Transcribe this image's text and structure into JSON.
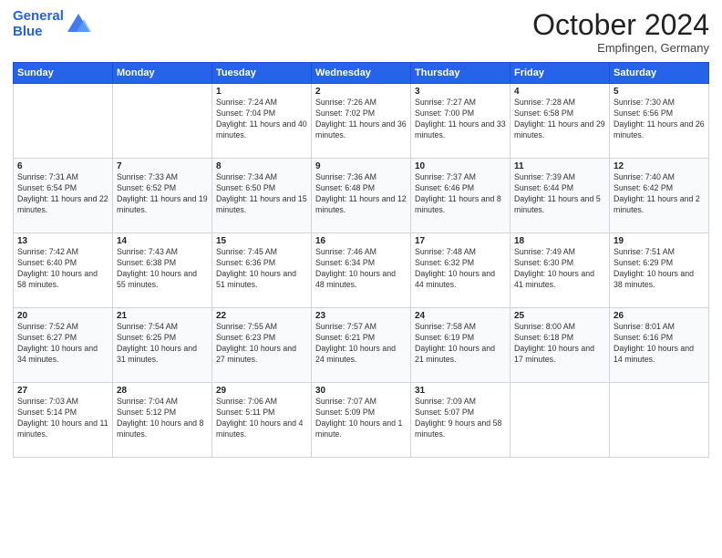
{
  "header": {
    "logo_line1": "General",
    "logo_line2": "Blue",
    "month": "October 2024",
    "location": "Empfingen, Germany"
  },
  "days_of_week": [
    "Sunday",
    "Monday",
    "Tuesday",
    "Wednesday",
    "Thursday",
    "Friday",
    "Saturday"
  ],
  "weeks": [
    [
      {
        "day": "",
        "info": ""
      },
      {
        "day": "",
        "info": ""
      },
      {
        "day": "1",
        "info": "Sunrise: 7:24 AM\nSunset: 7:04 PM\nDaylight: 11 hours and 40 minutes."
      },
      {
        "day": "2",
        "info": "Sunrise: 7:26 AM\nSunset: 7:02 PM\nDaylight: 11 hours and 36 minutes."
      },
      {
        "day": "3",
        "info": "Sunrise: 7:27 AM\nSunset: 7:00 PM\nDaylight: 11 hours and 33 minutes."
      },
      {
        "day": "4",
        "info": "Sunrise: 7:28 AM\nSunset: 6:58 PM\nDaylight: 11 hours and 29 minutes."
      },
      {
        "day": "5",
        "info": "Sunrise: 7:30 AM\nSunset: 6:56 PM\nDaylight: 11 hours and 26 minutes."
      }
    ],
    [
      {
        "day": "6",
        "info": "Sunrise: 7:31 AM\nSunset: 6:54 PM\nDaylight: 11 hours and 22 minutes."
      },
      {
        "day": "7",
        "info": "Sunrise: 7:33 AM\nSunset: 6:52 PM\nDaylight: 11 hours and 19 minutes."
      },
      {
        "day": "8",
        "info": "Sunrise: 7:34 AM\nSunset: 6:50 PM\nDaylight: 11 hours and 15 minutes."
      },
      {
        "day": "9",
        "info": "Sunrise: 7:36 AM\nSunset: 6:48 PM\nDaylight: 11 hours and 12 minutes."
      },
      {
        "day": "10",
        "info": "Sunrise: 7:37 AM\nSunset: 6:46 PM\nDaylight: 11 hours and 8 minutes."
      },
      {
        "day": "11",
        "info": "Sunrise: 7:39 AM\nSunset: 6:44 PM\nDaylight: 11 hours and 5 minutes."
      },
      {
        "day": "12",
        "info": "Sunrise: 7:40 AM\nSunset: 6:42 PM\nDaylight: 11 hours and 2 minutes."
      }
    ],
    [
      {
        "day": "13",
        "info": "Sunrise: 7:42 AM\nSunset: 6:40 PM\nDaylight: 10 hours and 58 minutes."
      },
      {
        "day": "14",
        "info": "Sunrise: 7:43 AM\nSunset: 6:38 PM\nDaylight: 10 hours and 55 minutes."
      },
      {
        "day": "15",
        "info": "Sunrise: 7:45 AM\nSunset: 6:36 PM\nDaylight: 10 hours and 51 minutes."
      },
      {
        "day": "16",
        "info": "Sunrise: 7:46 AM\nSunset: 6:34 PM\nDaylight: 10 hours and 48 minutes."
      },
      {
        "day": "17",
        "info": "Sunrise: 7:48 AM\nSunset: 6:32 PM\nDaylight: 10 hours and 44 minutes."
      },
      {
        "day": "18",
        "info": "Sunrise: 7:49 AM\nSunset: 6:30 PM\nDaylight: 10 hours and 41 minutes."
      },
      {
        "day": "19",
        "info": "Sunrise: 7:51 AM\nSunset: 6:29 PM\nDaylight: 10 hours and 38 minutes."
      }
    ],
    [
      {
        "day": "20",
        "info": "Sunrise: 7:52 AM\nSunset: 6:27 PM\nDaylight: 10 hours and 34 minutes."
      },
      {
        "day": "21",
        "info": "Sunrise: 7:54 AM\nSunset: 6:25 PM\nDaylight: 10 hours and 31 minutes."
      },
      {
        "day": "22",
        "info": "Sunrise: 7:55 AM\nSunset: 6:23 PM\nDaylight: 10 hours and 27 minutes."
      },
      {
        "day": "23",
        "info": "Sunrise: 7:57 AM\nSunset: 6:21 PM\nDaylight: 10 hours and 24 minutes."
      },
      {
        "day": "24",
        "info": "Sunrise: 7:58 AM\nSunset: 6:19 PM\nDaylight: 10 hours and 21 minutes."
      },
      {
        "day": "25",
        "info": "Sunrise: 8:00 AM\nSunset: 6:18 PM\nDaylight: 10 hours and 17 minutes."
      },
      {
        "day": "26",
        "info": "Sunrise: 8:01 AM\nSunset: 6:16 PM\nDaylight: 10 hours and 14 minutes."
      }
    ],
    [
      {
        "day": "27",
        "info": "Sunrise: 7:03 AM\nSunset: 5:14 PM\nDaylight: 10 hours and 11 minutes."
      },
      {
        "day": "28",
        "info": "Sunrise: 7:04 AM\nSunset: 5:12 PM\nDaylight: 10 hours and 8 minutes."
      },
      {
        "day": "29",
        "info": "Sunrise: 7:06 AM\nSunset: 5:11 PM\nDaylight: 10 hours and 4 minutes."
      },
      {
        "day": "30",
        "info": "Sunrise: 7:07 AM\nSunset: 5:09 PM\nDaylight: 10 hours and 1 minute."
      },
      {
        "day": "31",
        "info": "Sunrise: 7:09 AM\nSunset: 5:07 PM\nDaylight: 9 hours and 58 minutes."
      },
      {
        "day": "",
        "info": ""
      },
      {
        "day": "",
        "info": ""
      }
    ]
  ]
}
